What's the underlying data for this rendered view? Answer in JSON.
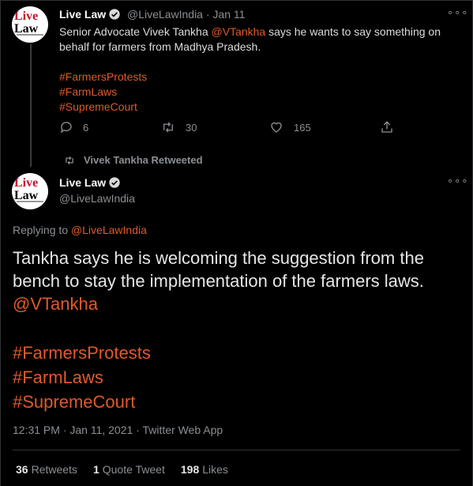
{
  "tweet1": {
    "avatar_text_top": "Live",
    "avatar_text_bottom": "Law",
    "name": "Live Law",
    "handle": "@LiveLawIndia",
    "separator": "·",
    "date": "Jan 11",
    "text_before": "Senior Advocate Vivek Tankha ",
    "mention": "@VTankha",
    "text_after": " says he wants to say something on behalf for farmers from Madhya Pradesh.",
    "hashtags": [
      "#FarmersProtests",
      "#FarmLaws",
      "#SupremeCourt"
    ],
    "replies": "6",
    "retweets": "30",
    "likes": "165",
    "more": "∘∘∘"
  },
  "retweet_context": {
    "label": "Vivek Tankha Retweeted"
  },
  "tweet2": {
    "avatar_text_top": "Live",
    "avatar_text_bottom": "Law",
    "name": "Live Law",
    "handle": "@LiveLawIndia",
    "more": "∘∘∘",
    "replying_label": "Replying to",
    "replying_to": "@LiveLawIndia",
    "text": "Tankha says he is welcoming the suggestion from the bench to stay the implementation of the farmers laws.",
    "mention": "@VTankha",
    "hashtags": [
      "#FarmersProtests",
      "#FarmLaws",
      "#SupremeCourt"
    ],
    "timestamp": "12:31 PM · Jan 11, 2021 · Twitter Web App",
    "stats": {
      "retweets_count": "36",
      "retweets_label": "Retweets",
      "quotes_count": "1",
      "quotes_label": "Quote Tweet",
      "likes_count": "198",
      "likes_label": "Likes"
    }
  },
  "colors": {
    "background": "#000000",
    "accent": "#e0592a",
    "muted": "#8b8f94",
    "brand_red": "#c8102e"
  }
}
